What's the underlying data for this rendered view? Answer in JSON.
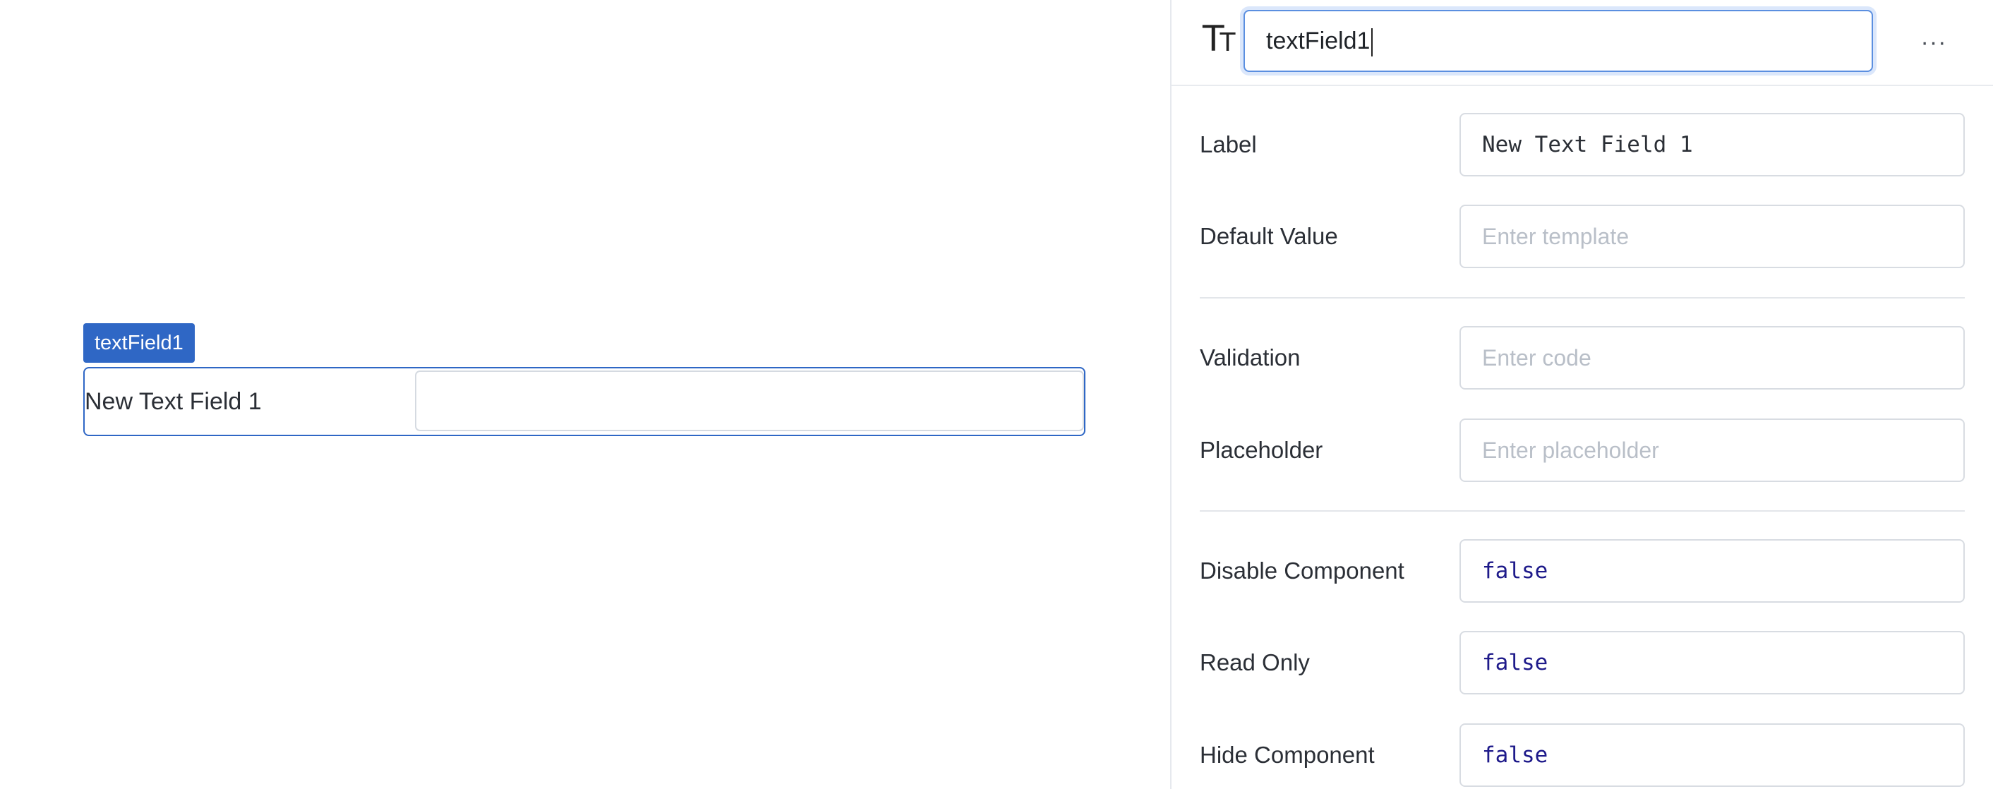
{
  "canvas": {
    "component_tag": "textField1",
    "widget_label": "New Text Field 1",
    "widget_value": ""
  },
  "inspector": {
    "type_icon": "text-type-icon",
    "component_name": "textField1",
    "more_icon": "more-horizontal-icon",
    "more_glyph": "···",
    "fields": {
      "label": {
        "label": "Label",
        "value": "New Text Field 1"
      },
      "default_value": {
        "label": "Default Value",
        "placeholder": "Enter template"
      },
      "validation": {
        "label": "Validation",
        "placeholder": "Enter code"
      },
      "placeholder": {
        "label": "Placeholder",
        "placeholder": "Enter placeholder"
      },
      "disable_component": {
        "label": "Disable Component",
        "value": "false"
      },
      "read_only": {
        "label": "Read Only",
        "value": "false"
      },
      "hide_component": {
        "label": "Hide Component",
        "value": "false"
      }
    }
  },
  "colors": {
    "accent": "#2f67c5",
    "code_text": "#1e1a8a",
    "placeholder_text": "#b9bfc8"
  }
}
